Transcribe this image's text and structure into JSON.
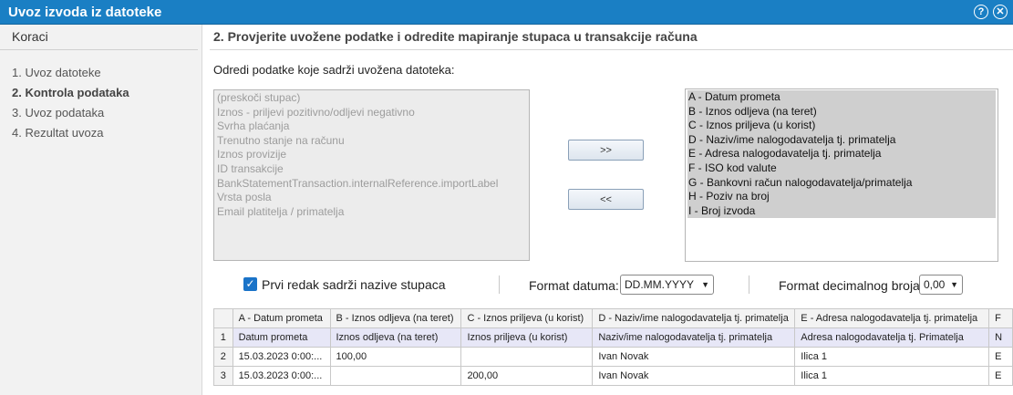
{
  "window": {
    "title": "Uvoz izvoda iz datoteke"
  },
  "sidebar": {
    "title": "Koraci",
    "items": [
      {
        "label": "1. Uvoz datoteke"
      },
      {
        "label": "2. Kontrola podataka"
      },
      {
        "label": "3. Uvoz podataka"
      },
      {
        "label": "4. Rezultat uvoza"
      }
    ],
    "active_index": 1
  },
  "main": {
    "step_title": "2. Provjerite uvožene podatke i odredite mapiranje stupaca u transakcije računa",
    "subtitle": "Odredi podatke koje sadrži uvožena datoteka:",
    "available_fields": [
      "(preskoči stupac)",
      "Iznos - priljevi pozitivno/odljevi negativno",
      "Svrha plaćanja",
      "Trenutno stanje na računu",
      "Iznos provizije",
      "ID transakcije",
      "BankStatementTransaction.internalReference.importLabel",
      "Vrsta posla",
      "Email platitelja / primatelja"
    ],
    "mapped_fields": [
      "A - Datum prometa",
      "B - Iznos odljeva (na teret)",
      "C - Iznos priljeva (u korist)",
      "D - Naziv/ime nalogodavatelja tj. primatelja",
      "E - Adresa nalogodavatelja tj. primatelja",
      "F - ISO kod valute",
      "G - Bankovni račun nalogodavatelja/primatelja",
      "H - Poziv na broj",
      "I - Broj izvoda"
    ],
    "move_right_label": ">>",
    "move_left_label": "<<",
    "options": {
      "first_row_label": "Prvi redak sadrži nazive stupaca",
      "first_row_checked": true,
      "date_format_label": "Format datuma:",
      "date_format_value": "DD.MM.YYYY",
      "decimal_format_label": "Format decimalnog broja:",
      "decimal_format_value": "0,00"
    },
    "preview": {
      "columns": [
        "A - Datum prometa",
        "B - Iznos odljeva (na teret)",
        "C - Iznos priljeva (u korist)",
        "D - Naziv/ime nalogodavatelja tj. primatelja",
        "E - Adresa nalogodavatelja tj. primatelja",
        "F"
      ],
      "rows": [
        {
          "num": "1",
          "cells": [
            "Datum prometa",
            "Iznos odljeva (na teret)",
            "Iznos priljeva (u korist)",
            "Naziv/ime nalogodavatelja tj. primatelja",
            "Adresa nalogodavatelja tj. Primatelja",
            "N"
          ]
        },
        {
          "num": "2",
          "cells": [
            "15.03.2023 0:00:...",
            "100,00",
            "",
            "Ivan Novak",
            "Ilica 1",
            "E"
          ]
        },
        {
          "num": "3",
          "cells": [
            "15.03.2023 0:00:...",
            "",
            "200,00",
            "Ivan Novak",
            "Ilica 1",
            "E"
          ]
        }
      ]
    }
  },
  "icons": {
    "help": "help-icon",
    "close": "close-icon",
    "check": "check-icon",
    "chevron": "chevron-down-icon"
  }
}
